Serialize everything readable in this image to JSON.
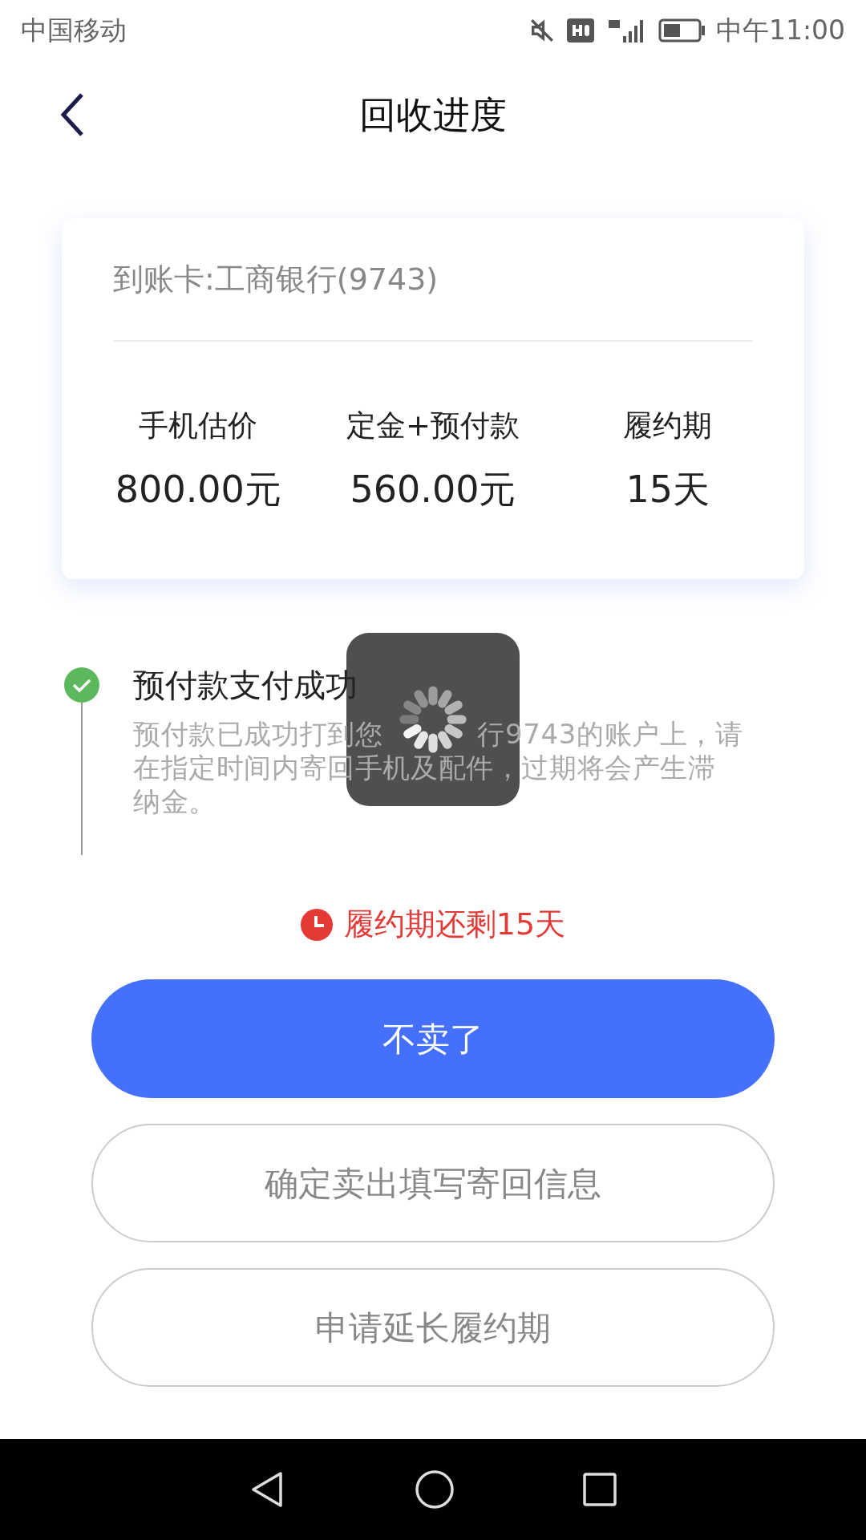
{
  "status_bar": {
    "carrier": "中国移动",
    "time": "中午11:00"
  },
  "header": {
    "title": "回收进度"
  },
  "card": {
    "account": "到账卡:工商银行(9743)",
    "stats": [
      {
        "label": "手机估价",
        "value": "800.00元"
      },
      {
        "label": "定金+预付款",
        "value": "560.00元"
      },
      {
        "label": "履约期",
        "value": "15天"
      }
    ]
  },
  "timeline": [
    {
      "title": "预付款支付成功",
      "description_lines": [
        {
          "segments": [
            "预付款已成功打到您",
            "行9743的账户上，请"
          ]
        },
        {
          "segments": [
            "在指定时间内寄回手机及配件，过期将会产生滞"
          ]
        },
        {
          "segments": [
            "纳金。"
          ]
        }
      ],
      "done": true
    }
  ],
  "countdown": "履约期还剩15天",
  "buttons": [
    {
      "label": "不卖了",
      "kind": "primary"
    },
    {
      "label": "确定卖出填写寄回信息",
      "kind": "outline"
    },
    {
      "label": "申请延长履约期",
      "kind": "outline"
    }
  ],
  "loading": true
}
